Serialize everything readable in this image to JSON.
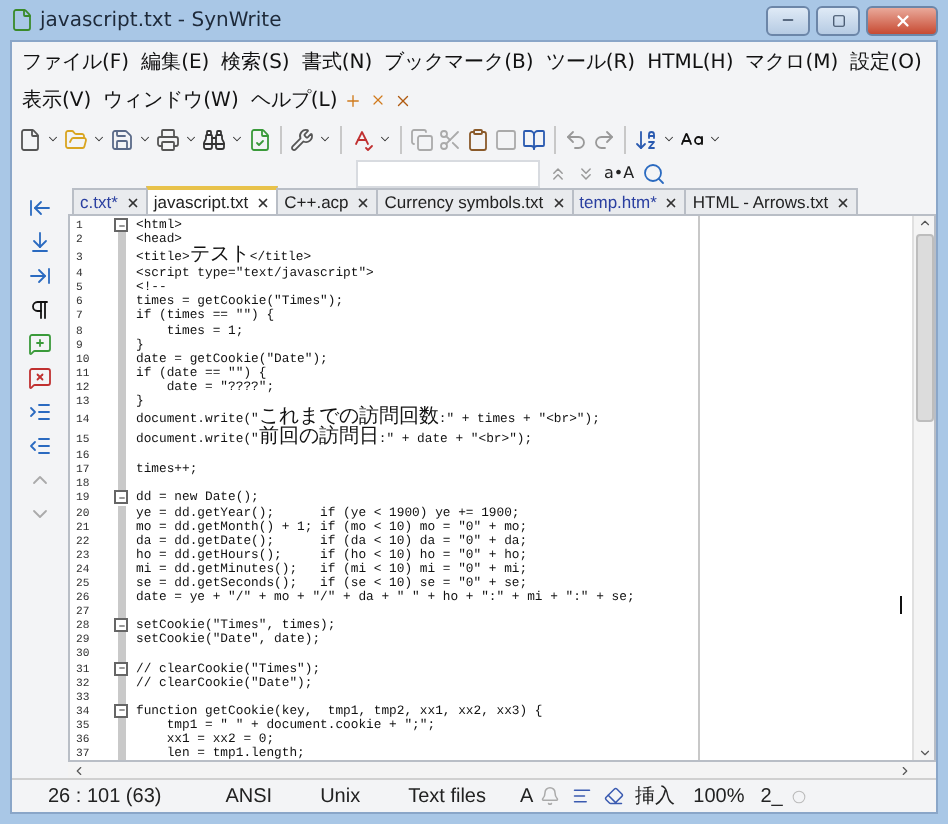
{
  "window": {
    "title": "javascript.txt - SynWrite"
  },
  "menu": [
    "ファイル(F)",
    "編集(E)",
    "検索(S)",
    "書式(N)",
    "ブックマーク(B)",
    "ツール(R)",
    "HTML(H)",
    "マクロ(M)",
    "設定(O)",
    "表示(V)",
    "ウィンドウ(W)",
    "ヘルプ(L)"
  ],
  "search_bar": {
    "case_toggle": "a•A"
  },
  "tabs": [
    {
      "label": "c.txt*",
      "modified": true,
      "selected": false
    },
    {
      "label": "javascript.txt",
      "modified": false,
      "selected": true
    },
    {
      "label": "C++.acp",
      "modified": false,
      "selected": false
    },
    {
      "label": "Currency symbols.txt",
      "modified": false,
      "selected": false
    },
    {
      "label": "temp.htm*",
      "modified": true,
      "selected": false
    },
    {
      "label": "HTML - Arrows.txt",
      "modified": false,
      "selected": false
    }
  ],
  "editor": {
    "lines": [
      {
        "n": "1",
        "text": "<html>",
        "fold": true
      },
      {
        "n": "2",
        "text": "<head>",
        "fold": false
      },
      {
        "n": "3",
        "text": "<title>テスト</title>",
        "fold": false
      },
      {
        "n": "4",
        "text": "<script type=\"text/javascript\">",
        "fold": false
      },
      {
        "n": "5",
        "text": "<!--",
        "fold": false
      },
      {
        "n": "6",
        "text": "times = getCookie(\"Times\");",
        "fold": false
      },
      {
        "n": "7",
        "text": "if (times == \"\") {",
        "fold": false
      },
      {
        "n": "8",
        "text": "    times = 1;",
        "fold": false
      },
      {
        "n": "9",
        "text": "}",
        "fold": false
      },
      {
        "n": "10",
        "text": "date = getCookie(\"Date\");",
        "fold": false
      },
      {
        "n": "11",
        "text": "if (date == \"\") {",
        "fold": false
      },
      {
        "n": "12",
        "text": "    date = \"????\";",
        "fold": false
      },
      {
        "n": "13",
        "text": "}",
        "fold": false
      },
      {
        "n": "14",
        "text": "document.write(\"これまでの訪問回数:\" + times + \"<br>\");",
        "fold": false
      },
      {
        "n": "15",
        "text": "document.write(\"前回の訪問日:\" + date + \"<br>\");",
        "fold": false
      },
      {
        "n": "16",
        "fold": false
      },
      {
        "n": "17",
        "text": "times++;",
        "fold": false
      },
      {
        "n": "18",
        "fold": false
      },
      {
        "n": "19",
        "text": "dd = new Date();",
        "fold": true
      },
      {
        "n": "20",
        "text": "ye = dd.getYear();      if (ye < 1900) ye += 1900;",
        "fold": false
      },
      {
        "n": "21",
        "text": "mo = dd.getMonth() + 1; if (mo < 10) mo = \"0\" + mo;",
        "fold": false
      },
      {
        "n": "22",
        "text": "da = dd.getDate();      if (da < 10) da = \"0\" + da;",
        "fold": false
      },
      {
        "n": "23",
        "text": "ho = dd.getHours();     if (ho < 10) ho = \"0\" + ho;",
        "fold": false
      },
      {
        "n": "24",
        "text": "mi = dd.getMinutes();   if (mi < 10) mi = \"0\" + mi;",
        "fold": false
      },
      {
        "n": "25",
        "text": "se = dd.getSeconds();   if (se < 10) se = \"0\" + se;",
        "fold": false
      },
      {
        "n": "26",
        "text": "date = ye + \"/\" + mo + \"/\" + da + \" \" + ho + \":\" + mi + \":\" + se;",
        "fold": false
      },
      {
        "n": "27",
        "fold": false
      },
      {
        "n": "28",
        "text": "setCookie(\"Times\", times);",
        "fold": true
      },
      {
        "n": "29",
        "text": "setCookie(\"Date\", date);",
        "fold": false
      },
      {
        "n": "30",
        "fold": false
      },
      {
        "n": "31",
        "text": "// clearCookie(\"Times\");",
        "fold": true
      },
      {
        "n": "32",
        "text": "// clearCookie(\"Date\");",
        "fold": false
      },
      {
        "n": "33",
        "fold": false
      },
      {
        "n": "34",
        "text": "function getCookie(key,  tmp1, tmp2, xx1, xx2, xx3) {",
        "fold": true
      },
      {
        "n": "35",
        "text": "    tmp1 = \" \" + document.cookie + \";\";",
        "fold": false
      },
      {
        "n": "36",
        "text": "    xx1 = xx2 = 0;",
        "fold": false
      },
      {
        "n": "37",
        "text": "    len = tmp1.length;",
        "fold": false
      }
    ]
  },
  "status_bar": {
    "position": "26 : 101 (63)",
    "encoding": "ANSI",
    "line_ending": "Unix",
    "file_type": "Text files",
    "font": "A",
    "mode": "挿入",
    "zoom": "100%",
    "field_8": "2_"
  }
}
